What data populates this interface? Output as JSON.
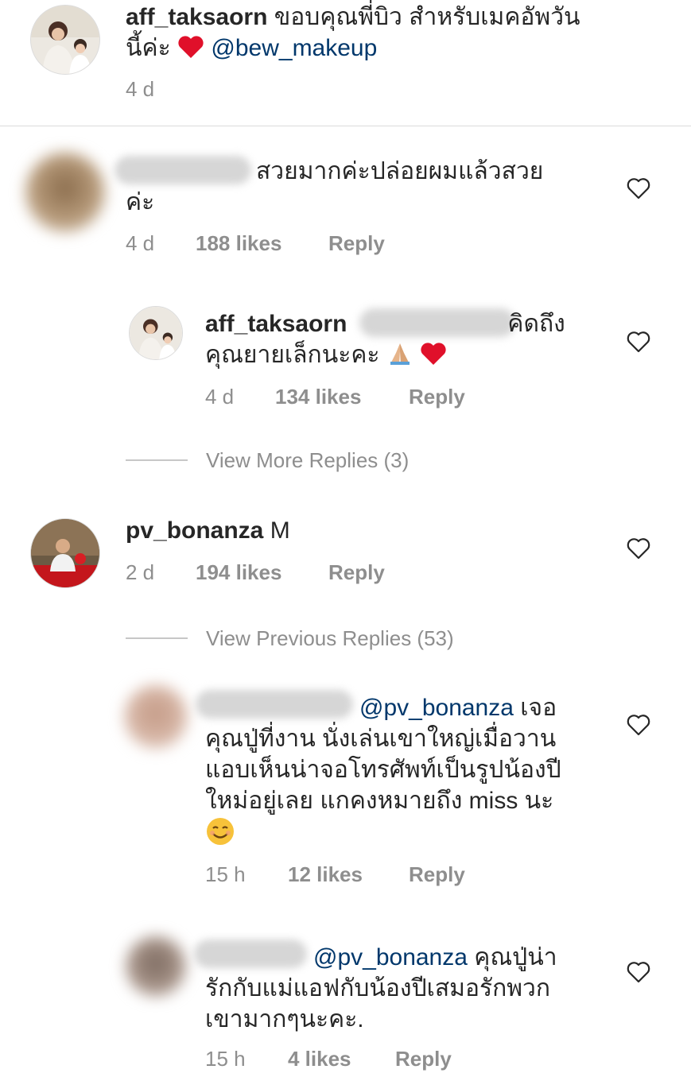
{
  "top_comment": {
    "username": "aff_taksaorn",
    "text_line1": "ขอบคุณพี่บิว สำหรับเมคอัพวัน",
    "text_line2": "นี้ค่ะ",
    "mention": "@bew_makeup",
    "time": "4 d"
  },
  "comment1": {
    "text_line1": "สวยมากค่ะปล่อยผมแล้วสวย",
    "text_line2": "ค่ะ",
    "time": "4 d",
    "likes": "188 likes",
    "reply": "Reply"
  },
  "reply1": {
    "username": "aff_taksaorn",
    "text_line1": "คิดถึง",
    "text_line2": "คุณยายเล็กนะคะ",
    "time": "4 d",
    "likes": "134 likes",
    "reply": "Reply"
  },
  "view_more_replies": "View More Replies (3)",
  "comment2": {
    "username": "pv_bonanza",
    "text": "M",
    "time": "2 d",
    "likes": "194 likes",
    "reply": "Reply"
  },
  "view_previous_replies": "View Previous Replies (53)",
  "reply2": {
    "mention": "@pv_bonanza",
    "text_line1": "เจอ",
    "text_line2": "คุณปู่ที่งาน นั่งเล่นเขาใหญ่เมื่อวาน",
    "text_line3": "แอบเห็นน่าจอโทรศัพท์เป็นรูปน้องปี",
    "text_line4": "ใหม่อยู่เลย แกคงหมายถึง miss นะ",
    "time": "15 h",
    "likes": "12 likes",
    "reply": "Reply"
  },
  "reply3": {
    "mention": "@pv_bonanza",
    "text_line1": "คุณปู่น่า",
    "text_line2": "รักกับแม่แอฟกับน้องปีเสมอรักพวก",
    "text_line3": "เขามากๆนะคะ.",
    "time": "15 h",
    "likes": "4 likes",
    "reply": "Reply"
  },
  "colors": {
    "text": "#262626",
    "meta": "#8e8e8e",
    "mention": "#00376b",
    "heart_red": "#e0102a",
    "divider": "#dbdbdb"
  },
  "icons": {
    "heart_outline": "heart-outline-icon",
    "red_heart": "red-heart-emoji",
    "pray": "folded-hands-emoji",
    "smile": "smiling-face-emoji"
  }
}
